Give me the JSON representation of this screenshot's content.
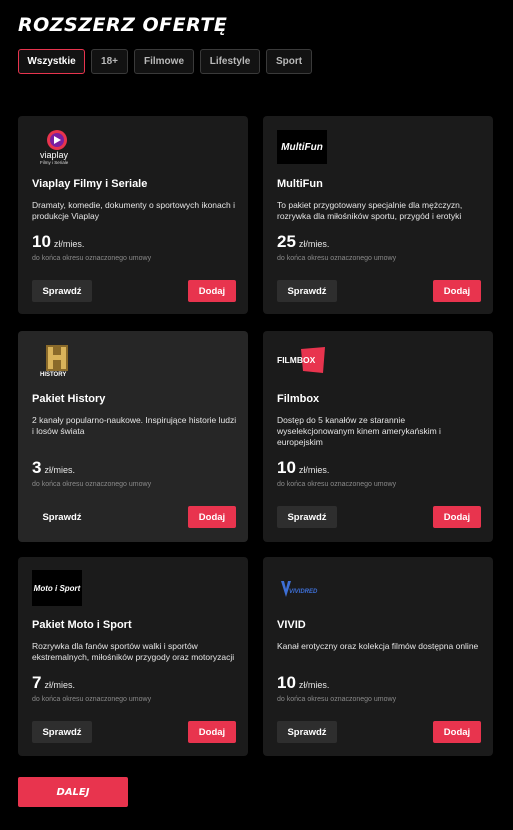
{
  "page": {
    "title": "ROZSZERZ OFERTĘ"
  },
  "filters": [
    {
      "label": "Wszystkie",
      "active": true
    },
    {
      "label": "18+",
      "active": false
    },
    {
      "label": "Filmowe",
      "active": false
    },
    {
      "label": "Lifestyle",
      "active": false
    },
    {
      "label": "Sport",
      "active": false
    }
  ],
  "cards": [
    {
      "logo_icon": "viaplay-logo",
      "logo_text": "viaplay",
      "logo_sub": "Filmy i Seriale",
      "name": "Viaplay Filmy i Seriale",
      "description": "Dramaty, komedie, dokumenty o sportowych ikonach i produkcje Viaplay",
      "price": "10",
      "price_unit": "zł/mies.",
      "price_note": "do końca okresu oznaczonego umowy",
      "check_label": "Sprawdź",
      "add_label": "Dodaj"
    },
    {
      "logo_icon": "multifun-logo",
      "logo_text": "MultiFun",
      "name": "MultiFun",
      "description": "To pakiet przygotowany specjalnie dla mężczyzn, rozrywka dla miłośników sportu, przygód i erotyki",
      "price": "25",
      "price_unit": "zł/mies.",
      "price_note": "do końca okresu oznaczonego umowy",
      "check_label": "Sprawdź",
      "add_label": "Dodaj"
    },
    {
      "logo_icon": "history-logo",
      "logo_text": "HISTORY",
      "name": "Pakiet History",
      "description": "2 kanały popularno-naukowe. Inspirujące historie ludzi i losów świata",
      "price": "3",
      "price_unit": "zł/mies.",
      "price_note": "do końca okresu oznaczonego umowy",
      "check_label": "Sprawdź",
      "add_label": "Dodaj"
    },
    {
      "logo_icon": "filmbox-logo",
      "logo_text": "FILMBOX",
      "name": "Filmbox",
      "description": "Dostęp do 5 kanałów ze starannie wyselekcjonowanym kinem amerykańskim i europejskim",
      "price": "10",
      "price_unit": "zł/mies.",
      "price_note": "do końca okresu oznaczonego umowy",
      "check_label": "Sprawdź",
      "add_label": "Dodaj"
    },
    {
      "logo_icon": "moto-i-sport-logo",
      "logo_text": "Moto i Sport",
      "name": "Pakiet Moto i Sport",
      "description": "Rozrywka dla fanów sportów walki i sportów ekstremalnych, miłośników przygody oraz motoryzacji",
      "price": "7",
      "price_unit": "zł/mies.",
      "price_note": "do końca okresu oznaczonego umowy",
      "check_label": "Sprawdź",
      "add_label": "Dodaj"
    },
    {
      "logo_icon": "vividred-logo",
      "logo_text": "VIVIDRED",
      "name": "VIVID",
      "description": "Kanał erotyczny oraz kolekcja filmów dostępna online",
      "price": "10",
      "price_unit": "zł/mies.",
      "price_note": "do końca okresu oznaczonego umowy",
      "check_label": "Sprawdź",
      "add_label": "Dodaj"
    }
  ],
  "next_button": {
    "label": "DALEJ"
  },
  "colors": {
    "accent": "#e8344e",
    "background": "#000000",
    "card": "#1b1b1b",
    "card_highlight": "#262626"
  }
}
